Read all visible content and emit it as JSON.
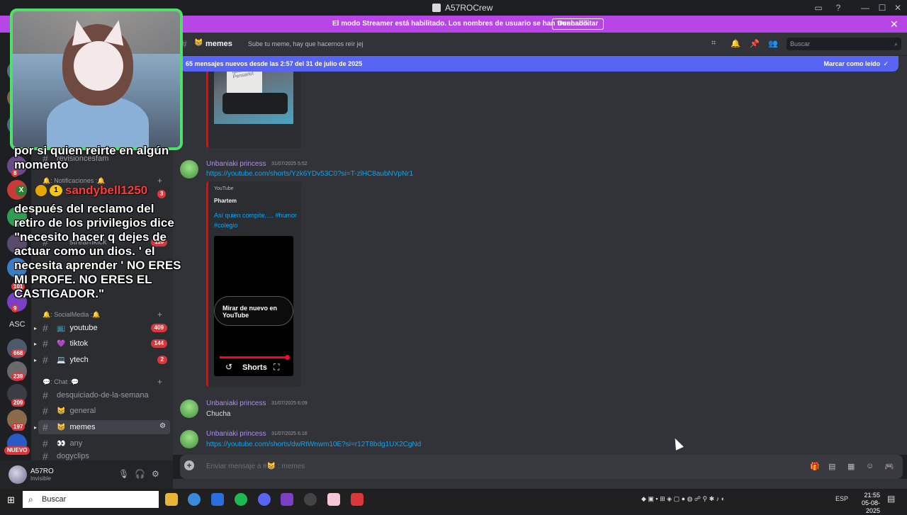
{
  "window": {
    "title": "A57ROCrew"
  },
  "streamer_banner": {
    "text": "El modo Streamer está habilitado. Los nombres de usuario se han truncado.",
    "button": "Deshabilitar"
  },
  "rail": {
    "badges": [
      "8",
      "101",
      "9",
      "668",
      "239",
      "209",
      "197"
    ],
    "asc_label": "ASC",
    "new_label": "NUEVO"
  },
  "sidebar": {
    "hidden_channels": [
      "revisioncesfam",
      "streamkick"
    ],
    "notif_category": "🔔: Notificaciones :🔔",
    "social_category": "🔔: SocialMedia :🔔",
    "chat_category": "💬: Chat :💬",
    "social_channels": [
      {
        "emoji": "📺",
        "name": "youtube",
        "count": "409"
      },
      {
        "emoji": "💜",
        "name": "tiktok",
        "count": "144"
      },
      {
        "emoji": "💻",
        "name": "ytech",
        "count": "2"
      }
    ],
    "chat_channels": [
      {
        "emoji": "",
        "name": "desquiciado-de-la-semana"
      },
      {
        "emoji": "😸",
        "name": "general"
      },
      {
        "emoji": "😸",
        "name": "memes"
      },
      {
        "emoji": "👀",
        "name": "any"
      },
      {
        "emoji": "",
        "name": "dogyclips"
      }
    ],
    "badge_notif": "3",
    "badge_streamkick": "110"
  },
  "user_panel": {
    "name": "A57RO",
    "status": "Invisible"
  },
  "chat_header": {
    "emoji": "😸",
    "channel": "memes",
    "topic": "Sube tu meme, hay que hacernos reír jej",
    "search_placeholder": "Buscar"
  },
  "new_messages": {
    "text": "65 mensajes nuevos desde las 2:57 del 31 de julio de 2025",
    "mark": "Marcar como leído"
  },
  "thumb_text": "quiero Pensarlo!",
  "messages": [
    {
      "author": "Unbaniaki princess",
      "time": "31/07/2025 5:52",
      "link": "https://youtube.com/shorts/Yzk6YDv53C0?si=T-zlHC8aubNVpNr1",
      "embed": {
        "provider": "YouTube",
        "name": "Phartem",
        "title": "Así quien compite..... #humor #colegio",
        "replay": "Mirar de nuevo en YouTube",
        "shorts": "Shorts"
      }
    },
    {
      "author": "Unbaniaki princess",
      "time": "31/07/2025 6:09",
      "text": "Chucha"
    },
    {
      "author": "Unbaniaki princess",
      "time": "31/07/2025 6:16",
      "link": "https://youtube.com/shorts/dwRtWnwm10E?si=r12T8bdg1UX2CgNd"
    }
  ],
  "composer": {
    "placeholder": "Enviar mensaje a #😸 : memes"
  },
  "overlay_chat": {
    "line_top": "por si quien reirte en algún",
    "line_top2": "momento",
    "user": "sandybell1250",
    "badge_number": "1",
    "message_lines": [
      "después del reclamo del",
      "retiro de los privilegios dice",
      "\"necesito hacer q dejes de",
      "actuar como un dios. ' el",
      "necesita aprender ' NO ERES",
      "MI PROFE. NO ERES EL",
      "CASTIGADOR.\""
    ]
  },
  "taskbar": {
    "search": "Buscar",
    "lang": "ESP",
    "time": "21:55",
    "date": "05-08-2025"
  },
  "colors": {
    "accent": "#5865f2",
    "banner": "#b845e6",
    "author": "#b18cf0",
    "link": "#00a8fc",
    "badge": "#da373c",
    "webcam_border": "#4fe06a"
  }
}
